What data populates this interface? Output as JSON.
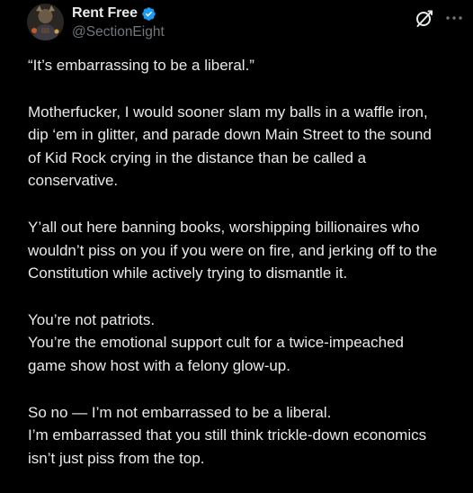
{
  "author": {
    "display_name": "Rent Free",
    "handle": "@SectionEight",
    "verified": true,
    "verified_color": "#1d9bf0"
  },
  "icons": {
    "avatar": "avatar-image",
    "verified": "verified-badge-icon",
    "grok": "grok-icon",
    "more": "more-options-icon"
  },
  "tweet": {
    "paragraphs": [
      {
        "lines": [
          "“It’s embarrassing to be a liberal.”"
        ]
      },
      {
        "lines": [
          "Motherfucker, I would sooner slam my balls in a waffle iron,",
          "dip ‘em in glitter, and parade down Main Street to the sound",
          "of Kid Rock crying in the distance than be called a",
          "conservative."
        ]
      },
      {
        "lines": [
          "Y’all out here banning books, worshipping billionaires who",
          "wouldn’t piss on you if you were on fire, and jerking off to the",
          "Constitution while actively trying to dismantle it."
        ]
      },
      {
        "lines": [
          "You’re not patriots.",
          "You’re the emotional support cult for a twice-impeached",
          "game show host with a felony glow-up."
        ]
      },
      {
        "lines": [
          "So no — I’m not embarrassed to be a liberal.",
          "I’m embarrassed that you still think trickle-down economics",
          "isn’t just piss from the top."
        ]
      }
    ]
  }
}
